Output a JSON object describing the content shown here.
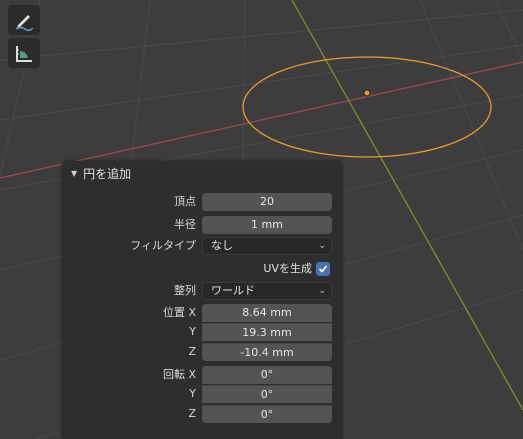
{
  "panel": {
    "title": "円を追加",
    "collapse_icon": "▼",
    "vertices": {
      "label": "頂点",
      "value": "20"
    },
    "radius": {
      "label": "半径",
      "value": "1 mm"
    },
    "fill_type": {
      "label": "フィルタイプ",
      "value": "なし"
    },
    "generate_uv": {
      "label": "UVを生成",
      "checked": true
    },
    "align": {
      "label": "整列",
      "value": "ワールド"
    },
    "location": {
      "label": "位置",
      "x": {
        "axis": "X",
        "value": "8.64 mm"
      },
      "y": {
        "axis": "Y",
        "value": "19.3 mm"
      },
      "z": {
        "axis": "Z",
        "value": "-10.4 mm"
      }
    },
    "rotation": {
      "label": "回転",
      "x": {
        "axis": "X",
        "value": "0°"
      },
      "y": {
        "axis": "Y",
        "value": "0°"
      },
      "z": {
        "axis": "Z",
        "value": "0°"
      }
    }
  },
  "toolbar": {
    "tools": [
      "annotate-tool",
      "measure-tool"
    ]
  },
  "colors": {
    "viewport_bg": "#3d3d3d",
    "x_axis": "#a44a55",
    "y_axis": "#7a9a2a",
    "circle": "#e89a2c",
    "checkbox": "#4772b3"
  }
}
